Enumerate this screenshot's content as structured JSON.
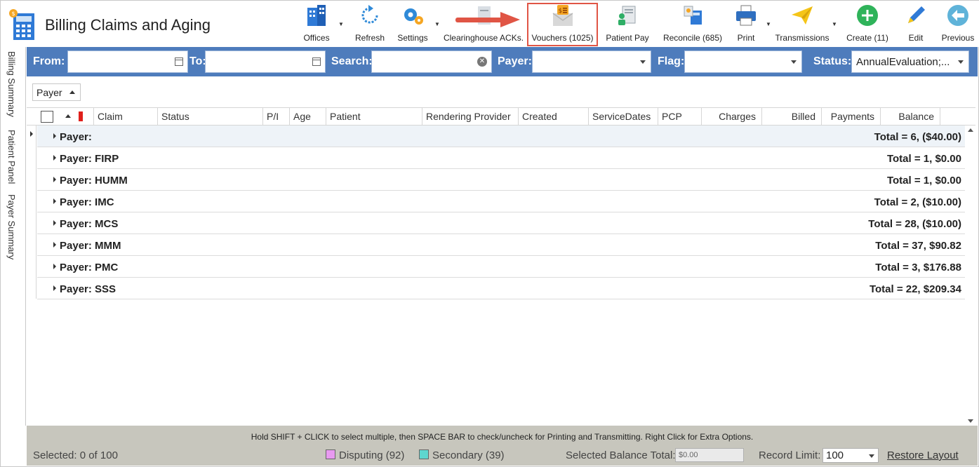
{
  "app": {
    "title": "Billing Claims and Aging"
  },
  "toolbar": {
    "offices": "Offices",
    "refresh": "Refresh",
    "settings": "Settings",
    "clearinghouse": "Clearinghouse ACKs.",
    "vouchers": "Vouchers (1025)",
    "patient_pay": "Patient Pay",
    "reconcile": "Reconcile (685)",
    "print": "Print",
    "transmissions": "Transmissions",
    "create": "Create (11)",
    "edit": "Edit",
    "previous": "Previous"
  },
  "side_tabs": [
    "Billing Summary",
    "Patient Panel",
    "Payer Summary"
  ],
  "filters": {
    "from_label": "From:",
    "to_label": "To:",
    "search_label": "Search:",
    "payer_label": "Payer:",
    "flag_label": "Flag:",
    "status_label": "Status:",
    "status_value": "AnnualEvaluation;..."
  },
  "group_by": "Payer",
  "columns": [
    "Claim",
    "Status",
    "P/I",
    "Age",
    "Patient",
    "Rendering Provider",
    "Created",
    "ServiceDates",
    "PCP",
    "Charges",
    "Billed",
    "Payments",
    "Balance"
  ],
  "groups": [
    {
      "name": "Payer:",
      "total": "Total = 6,  ($40.00)"
    },
    {
      "name": "Payer: FIRP",
      "total": "Total = 1,  $0.00"
    },
    {
      "name": "Payer: HUMM",
      "total": "Total = 1,  $0.00"
    },
    {
      "name": "Payer: IMC",
      "total": "Total = 2,  ($10.00)"
    },
    {
      "name": "Payer: MCS",
      "total": "Total = 28,  ($10.00)"
    },
    {
      "name": "Payer: MMM",
      "total": "Total = 37,  $90.82"
    },
    {
      "name": "Payer: PMC",
      "total": "Total = 3,  $176.88"
    },
    {
      "name": "Payer: SSS",
      "total": "Total = 22,  $209.34"
    }
  ],
  "footer": {
    "hint": "Hold SHIFT + CLICK to select multiple, then SPACE BAR to check/uncheck for Printing and Transmitting. Right Click for Extra Options.",
    "selected": "Selected: 0 of 100",
    "disputing": "Disputing (92)",
    "secondary": "Secondary (39)",
    "selected_balance_label": "Selected Balance Total:",
    "selected_balance_value": "$0.00",
    "record_limit_label": "Record Limit:",
    "record_limit_value": "100",
    "restore_layout": "Restore Layout"
  },
  "colors": {
    "filter_bar": "#4e7cbc",
    "footer": "#c7c6bd",
    "highlight": "#e05545",
    "disputing": "#e89af0",
    "secondary": "#5fd6cf"
  }
}
